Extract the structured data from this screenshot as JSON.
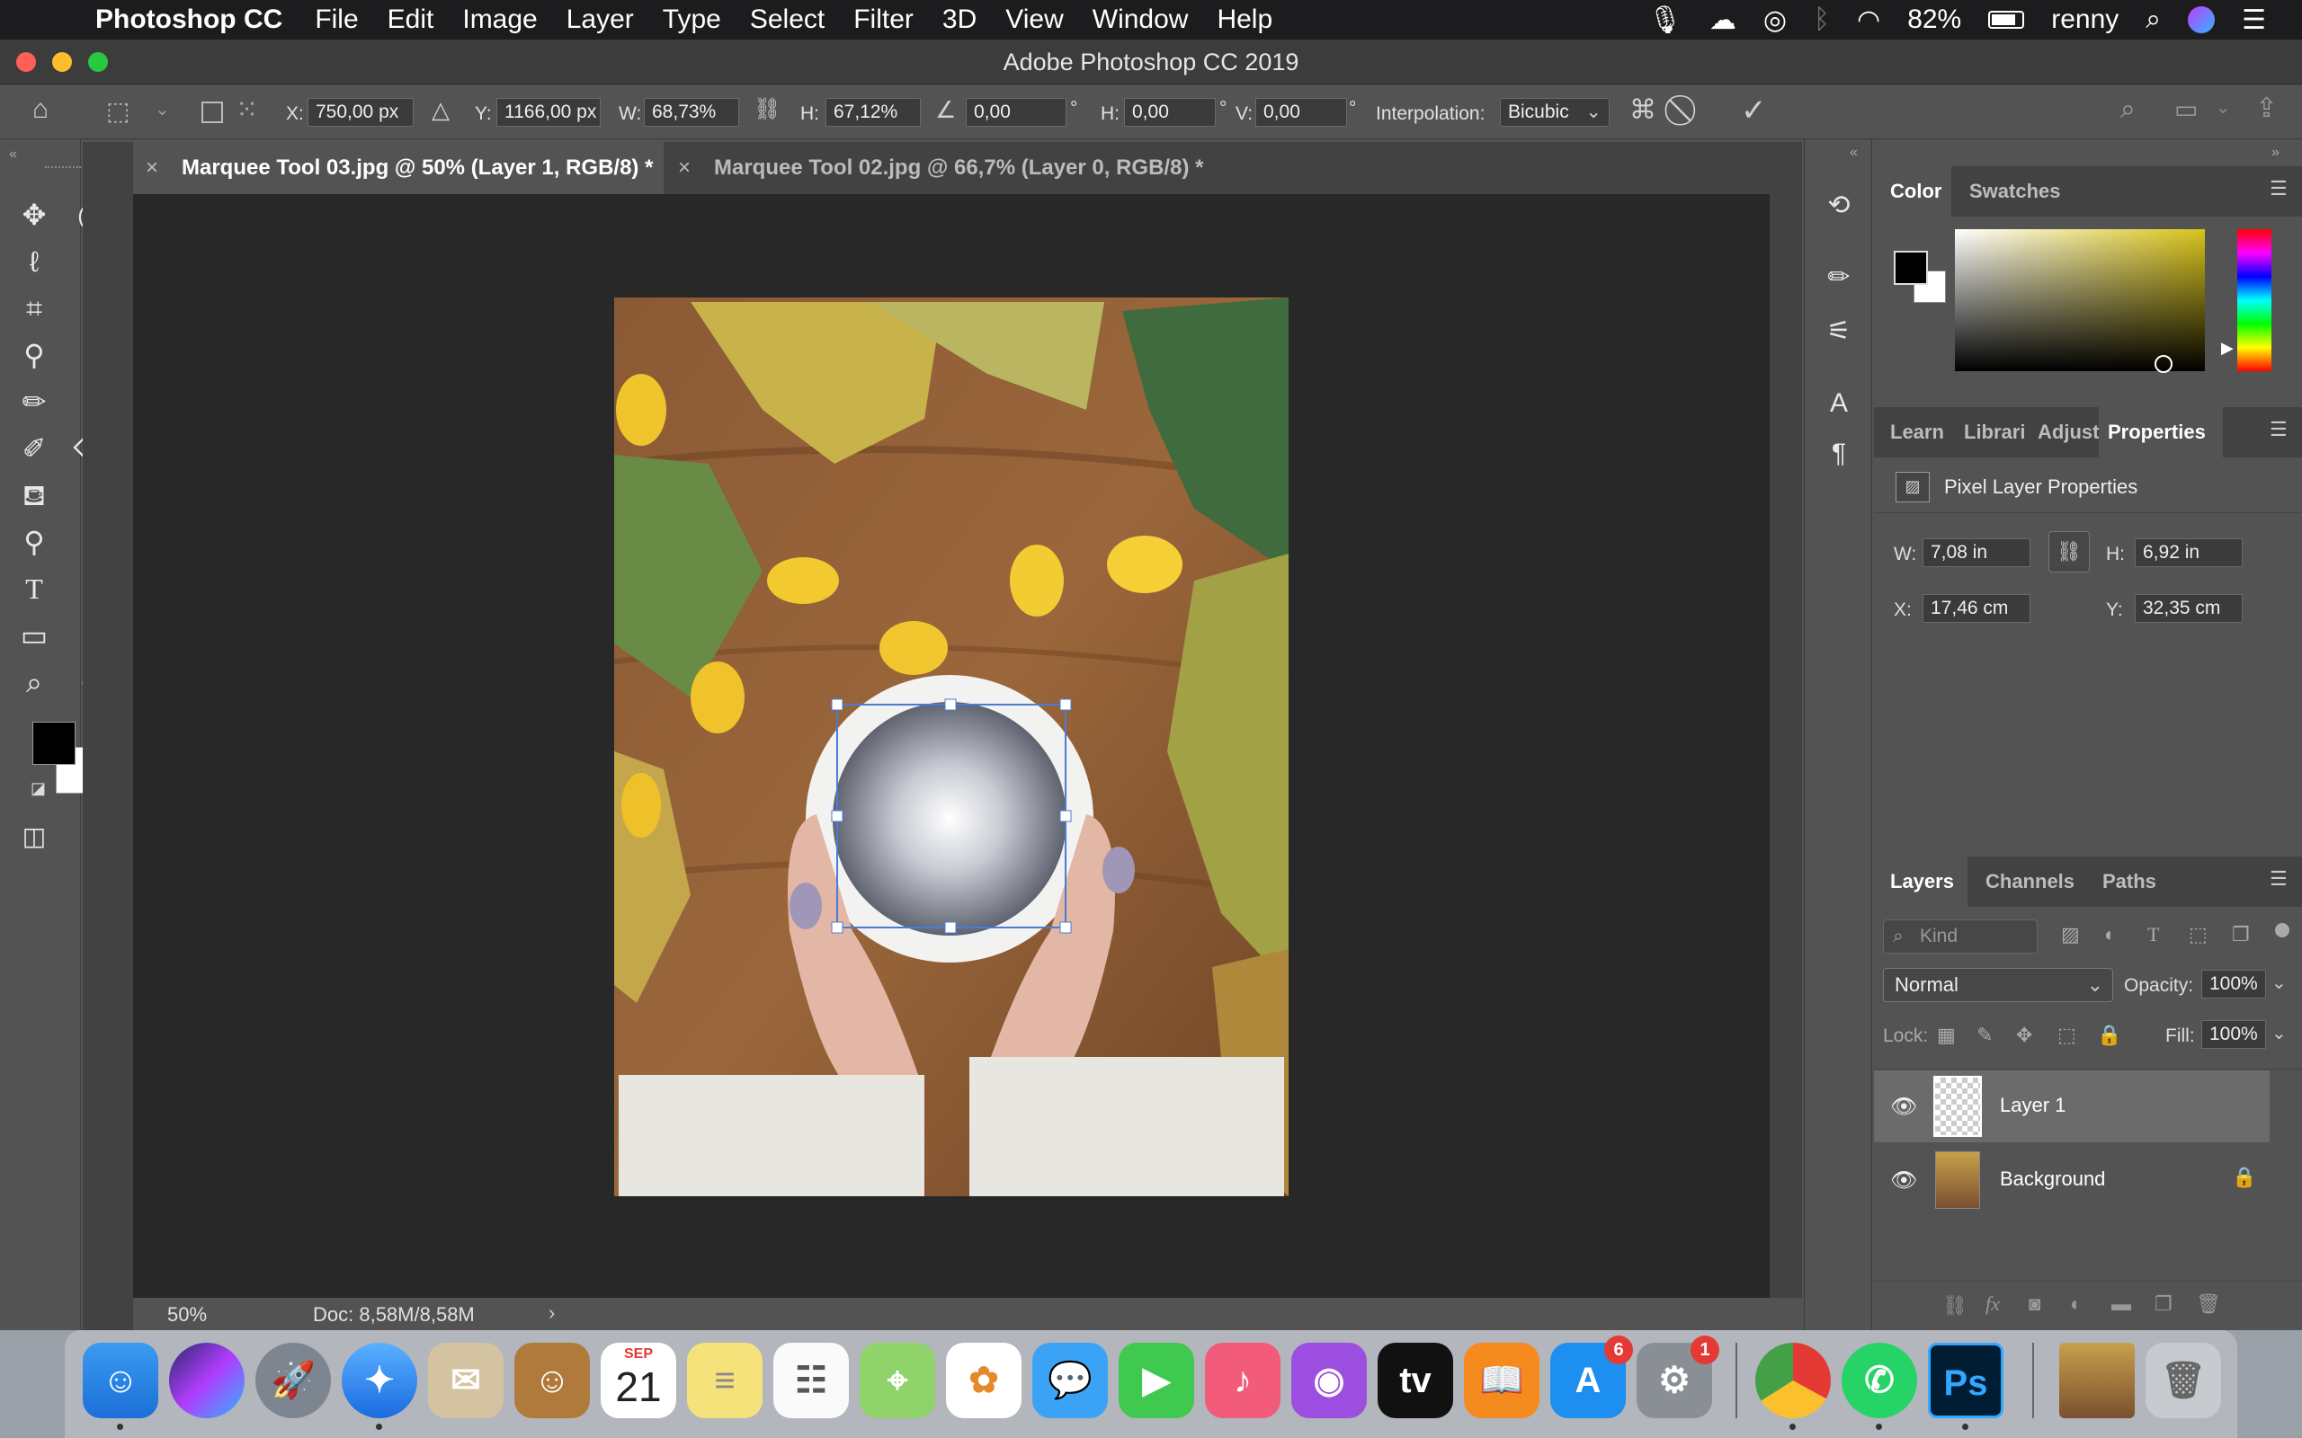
{
  "menubar": {
    "app_name": "Photoshop CC",
    "items": [
      "File",
      "Edit",
      "Image",
      "Layer",
      "Type",
      "Select",
      "Filter",
      "3D",
      "View",
      "Window",
      "Help"
    ],
    "battery": "82%",
    "user": "renny"
  },
  "window": {
    "title": "Adobe Photoshop CC 2019"
  },
  "options": {
    "x_label": "X:",
    "x_value": "750,00 px",
    "y_label": "Y:",
    "y_value": "1166,00 px",
    "w_label": "W:",
    "w_value": "68,73%",
    "h_label": "H:",
    "h_value": "67,12%",
    "angle_value": "0,00",
    "degree": "°",
    "hskew_label": "H:",
    "hskew_value": "0,00",
    "vskew_label": "V:",
    "vskew_value": "0,00",
    "interp_label": "Interpolation:",
    "interp_value": "Bicubic"
  },
  "tabs": [
    {
      "label": "Marquee Tool 03.jpg @ 50% (Layer 1, RGB/8) *",
      "active": true
    },
    {
      "label": "Marquee Tool 02.jpg @ 66,7% (Layer 0, RGB/8) *",
      "active": false
    }
  ],
  "status": {
    "zoom": "50%",
    "doc": "Doc: 8,58M/8,58M"
  },
  "color_panel": {
    "tabs": [
      "Color",
      "Swatches"
    ],
    "foreground": "#000000",
    "background": "#ffffff"
  },
  "properties_panel": {
    "tabs": [
      "Learn",
      "Librari",
      "Adjust",
      "Properties"
    ],
    "title": "Pixel Layer Properties",
    "w_label": "W:",
    "w_value": "7,08 in",
    "h_label": "H:",
    "h_value": "6,92 in",
    "x_label": "X:",
    "x_value": "17,46 cm",
    "y_label": "Y:",
    "y_value": "32,35 cm"
  },
  "layers_panel": {
    "tabs": [
      "Layers",
      "Channels",
      "Paths"
    ],
    "kind_placeholder": "Kind",
    "blend_mode": "Normal",
    "opacity_label": "Opacity:",
    "opacity_value": "100%",
    "lock_label": "Lock:",
    "fill_label": "Fill:",
    "fill_value": "100%",
    "layers": [
      {
        "name": "Layer 1",
        "selected": true
      },
      {
        "name": "Background",
        "selected": false
      }
    ]
  },
  "dock": {
    "calendar_month": "SEP",
    "calendar_day": "21",
    "appstore_badge": "6",
    "prefs_badge": "1",
    "ps_label": "Ps"
  }
}
